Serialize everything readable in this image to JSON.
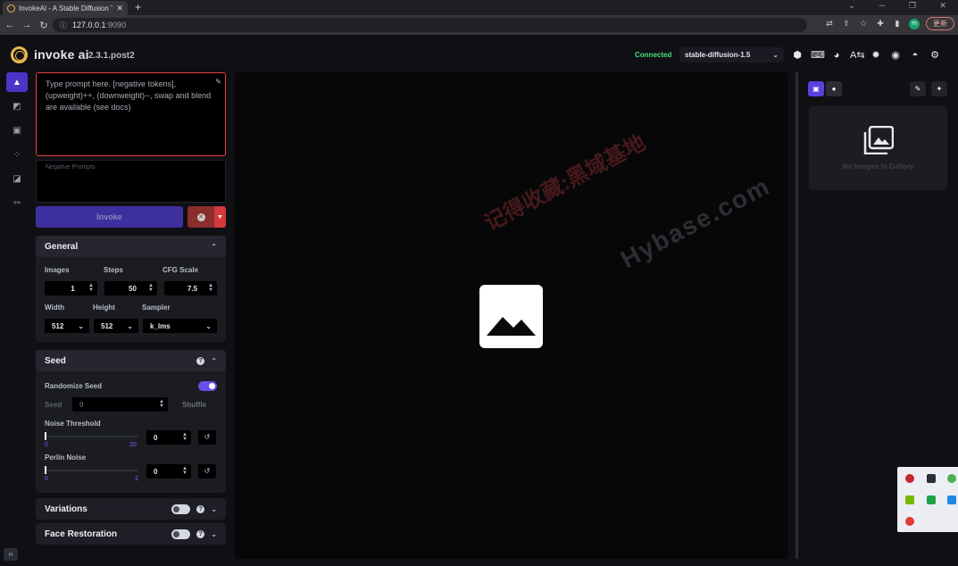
{
  "browser": {
    "tab_title": "InvokeAI - A Stable Diffusion T",
    "tab_close": "✕",
    "new_tab": "+",
    "url_host": "127.0.0.1",
    "url_port": ":9090",
    "update_label": "更新",
    "profile_initial": "m"
  },
  "header": {
    "brand": "invoke ai",
    "version": "2.3.1.post2",
    "status": "Connected",
    "model": "stable-diffusion-1.5"
  },
  "prompt": {
    "placeholder": "Type prompt here. [negative tokens], (upweight)++, (downweight)--, swap and blend are available (see docs)",
    "negative_placeholder": "Negative Prompts"
  },
  "invoke_label": "Invoke",
  "general": {
    "title": "General",
    "images_label": "Images",
    "images_value": "1",
    "steps_label": "Steps",
    "steps_value": "50",
    "cfg_label": "CFG Scale",
    "cfg_value": "7.5",
    "width_label": "Width",
    "width_value": "512",
    "height_label": "Height",
    "height_value": "512",
    "sampler_label": "Sampler",
    "sampler_value": "k_lms"
  },
  "seed": {
    "title": "Seed",
    "randomize_label": "Randomize Seed",
    "randomize_on": true,
    "seed_label": "Seed",
    "seed_value": "0",
    "shuffle_label": "Shuffle",
    "noise_label": "Noise Threshold",
    "noise_min": "0",
    "noise_max": "20",
    "noise_value": "0",
    "perlin_label": "Perlin Noise",
    "perlin_min": "0",
    "perlin_max": "1",
    "perlin_value": "0"
  },
  "variations": {
    "title": "Variations",
    "enabled": false
  },
  "face_restoration": {
    "title": "Face Restoration",
    "enabled": false
  },
  "gallery": {
    "empty_text": "No Images In Gallery"
  },
  "watermark": {
    "line1": "记得收藏:黑域基地",
    "line2": "Hybase.com"
  },
  "colors": {
    "accent": "#5b3fe0",
    "connected": "#4ade80",
    "danger": "#d33a3a",
    "logo": "#e8b84a"
  }
}
